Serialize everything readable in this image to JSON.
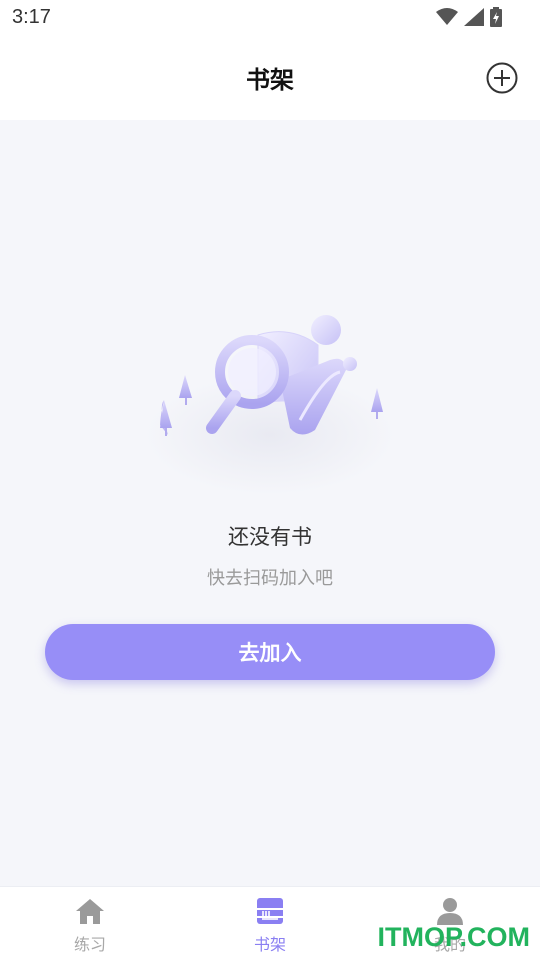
{
  "status_bar": {
    "time": "3:17"
  },
  "header": {
    "title": "书架",
    "add_icon": "plus-circle-icon"
  },
  "empty_state": {
    "illustration_icon": "search-book-illustration",
    "title": "还没有书",
    "subtitle": "快去扫码加入吧",
    "button_label": "去加入"
  },
  "tab_bar": {
    "tabs": [
      {
        "label": "练习",
        "icon": "home-icon",
        "active": false
      },
      {
        "label": "书架",
        "icon": "bookshelf-icon",
        "active": true
      },
      {
        "label": "我的",
        "icon": "person-icon",
        "active": false
      }
    ]
  },
  "watermark": "ITMOP.COM",
  "colors": {
    "accent": "#978ef7",
    "accent_text": "#8a7ff2",
    "background": "#f5f6fa",
    "watermark": "#22b35d"
  }
}
